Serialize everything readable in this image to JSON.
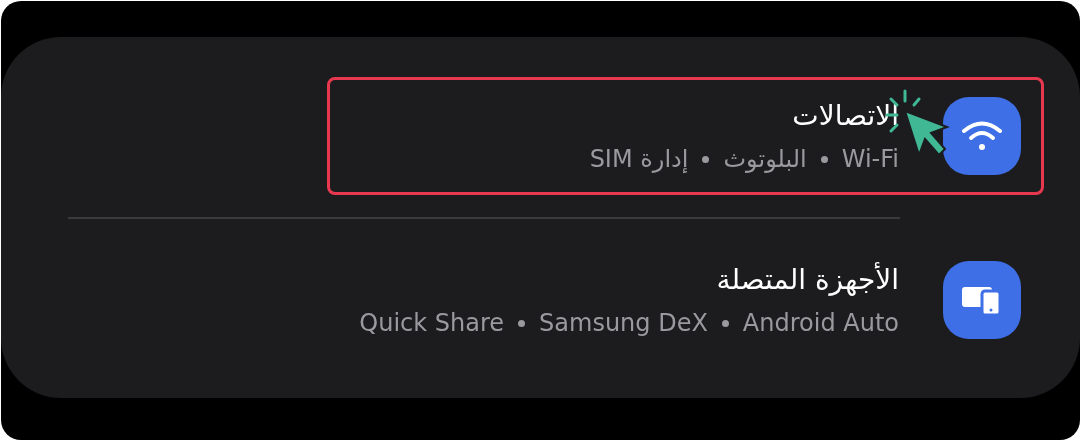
{
  "rows": [
    {
      "kind": "wifi",
      "title": "الاتصالات",
      "subtitle": [
        "Wi-Fi",
        "البلوتوث",
        "إدارة SIM"
      ],
      "highlighted": true
    },
    {
      "kind": "devices",
      "title": "الأجهزة المتصلة",
      "subtitle": [
        "Android Auto",
        "Samsung DeX",
        "Quick Share"
      ],
      "highlighted": false
    }
  ]
}
